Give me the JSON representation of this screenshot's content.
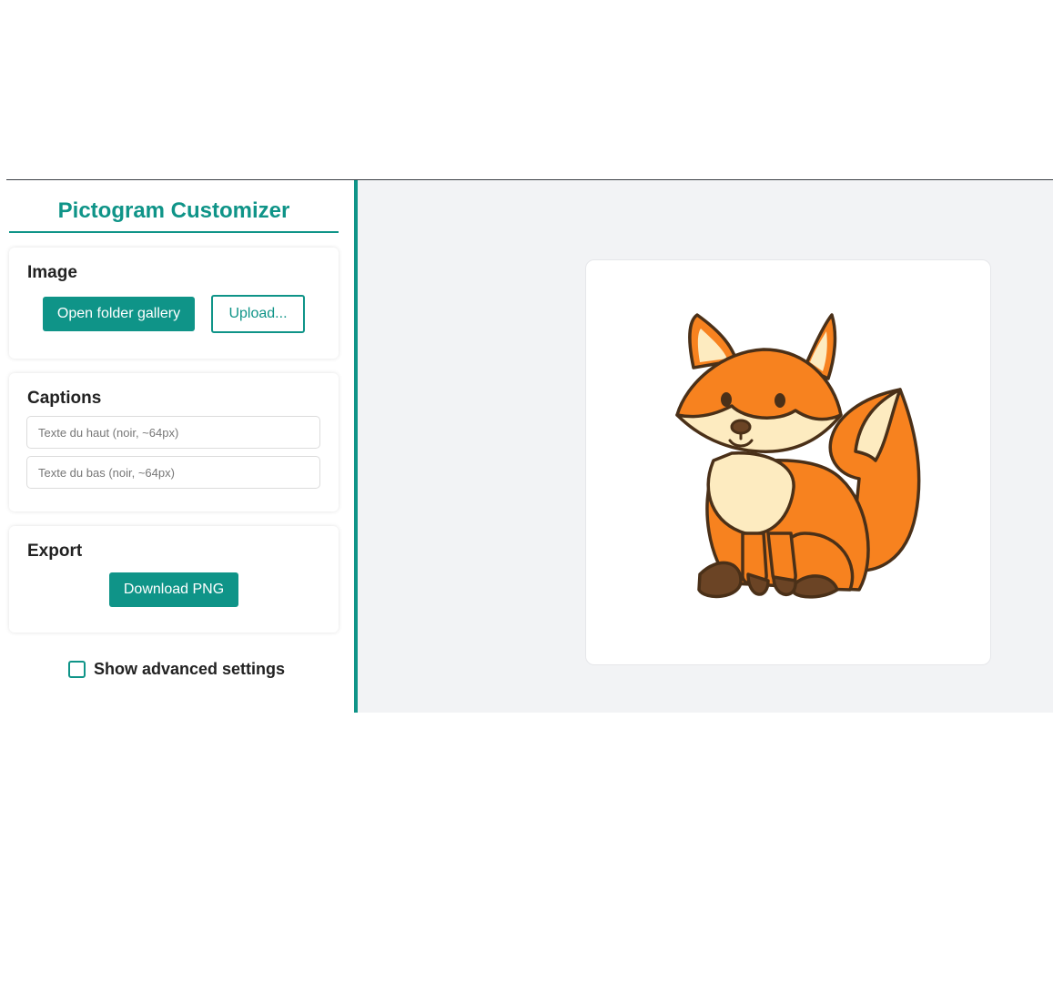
{
  "sidebar": {
    "title": "Pictogram Customizer",
    "image_section": {
      "heading": "Image",
      "gallery_button": "Open folder gallery",
      "upload_button": "Upload..."
    },
    "captions_section": {
      "heading": "Captions",
      "top_placeholder": "Texte du haut (noir, ~64px)",
      "bottom_placeholder": "Texte du bas (noir, ~64px)",
      "top_value": "",
      "bottom_value": ""
    },
    "export_section": {
      "heading": "Export",
      "download_button": "Download PNG"
    },
    "advanced_label": "Show advanced settings",
    "advanced_checked": false
  },
  "preview": {
    "image": "fox-pictogram"
  },
  "colors": {
    "accent": "#0f9488",
    "preview_bg": "#f2f3f5",
    "fox_orange": "#f7821f",
    "fox_cream": "#fdebc0",
    "fox_brown": "#6b4425",
    "outline": "#4a3018"
  }
}
